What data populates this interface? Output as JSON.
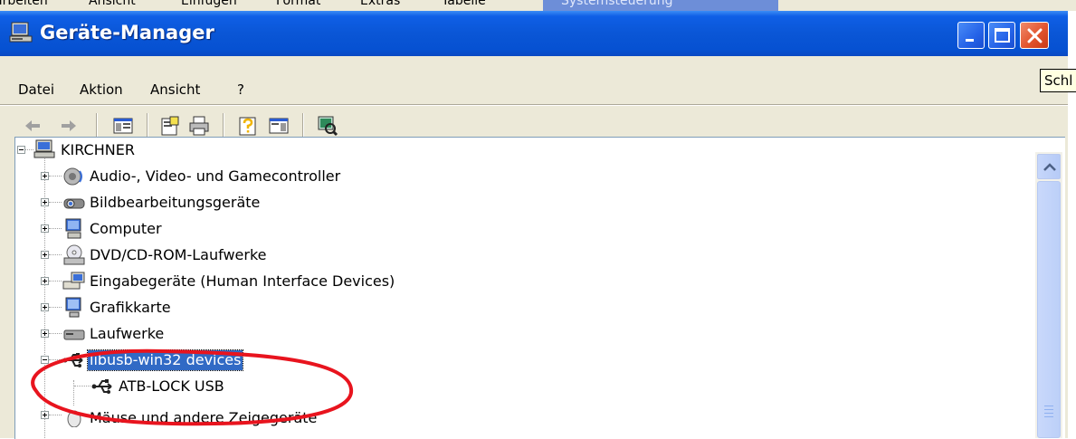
{
  "background_menu": [
    "arbeiten",
    "Ansicht",
    "Einfügen",
    "Format",
    "Extras",
    "Tabelle"
  ],
  "background_task": "Systemsteuerung",
  "window": {
    "title": "Geräte-Manager"
  },
  "tooltip": "Schl",
  "menubar": {
    "items": [
      "Datei",
      "Aktion",
      "Ansicht",
      "?"
    ]
  },
  "toolbar": {
    "icons": [
      "back-arrow-icon",
      "forward-arrow-icon",
      "console-tree-icon",
      "properties-icon",
      "print-icon",
      "help-icon",
      "view-icon",
      "scan-hardware-icon"
    ]
  },
  "tree": {
    "root": "KIRCHNER",
    "items": [
      {
        "label": "Audio-, Video- und Gamecontroller",
        "icon": "speaker-icon"
      },
      {
        "label": "Bildbearbeitungsgeräte",
        "icon": "camera-icon"
      },
      {
        "label": "Computer",
        "icon": "computer-icon"
      },
      {
        "label": "DVD/CD-ROM-Laufwerke",
        "icon": "cd-drive-icon"
      },
      {
        "label": "Eingabegeräte (Human Interface Devices)",
        "icon": "hid-icon"
      },
      {
        "label": "Grafikkarte",
        "icon": "display-adapter-icon"
      },
      {
        "label": "Laufwerke",
        "icon": "disk-drive-icon"
      },
      {
        "label": "libusb-win32 devices",
        "icon": "usb-icon",
        "selected": true,
        "expanded": true,
        "children": [
          {
            "label": "ATB-LOCK USB",
            "icon": "usb-icon"
          }
        ]
      },
      {
        "label": "Mäuse und andere Zeigegeräte",
        "icon": "mouse-icon"
      }
    ]
  },
  "colors": {
    "title_bar": "#0a56d6",
    "selection": "#316ac5",
    "annotation": "#e8141e",
    "chrome": "#ece9d8"
  }
}
